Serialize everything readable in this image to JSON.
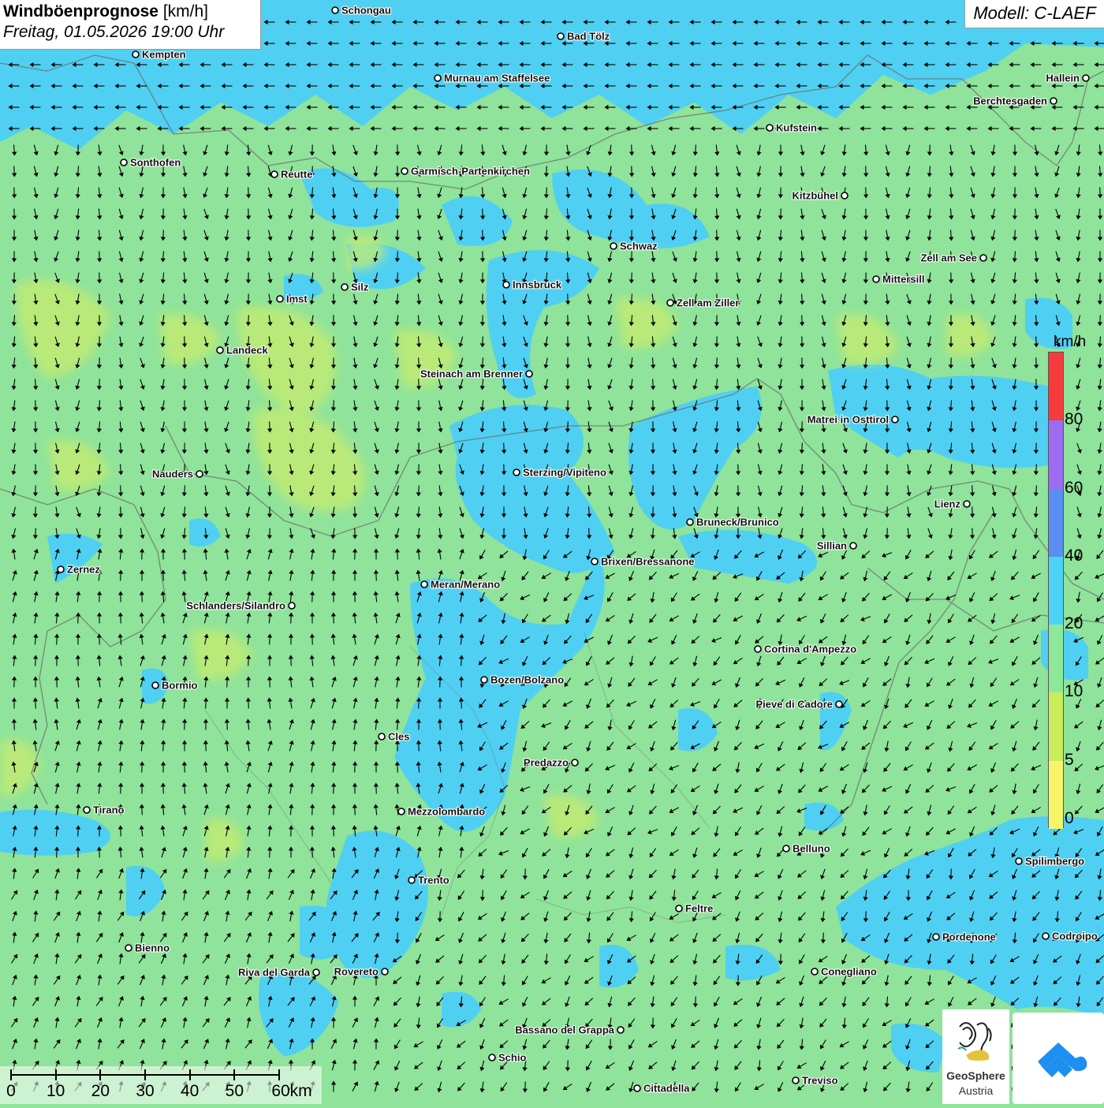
{
  "header": {
    "title_bold": "Windböenprognose",
    "title_unit": "[km/h]",
    "subtitle": "Freitag, 01.05.2026 19:00 Uhr",
    "model": "Modell: C-LAEF"
  },
  "legend": {
    "unit": "km/h",
    "ticks": [
      "80",
      "60",
      "40",
      "20",
      "10",
      "5",
      "0"
    ],
    "colors": [
      "#f53b3b",
      "#9b6cf0",
      "#5a8ef0",
      "#4cd2f5",
      "#8ee89a",
      "#c8ee5a",
      "#f6f56a"
    ]
  },
  "scale_bar": {
    "labels": [
      "0",
      "10",
      "20",
      "30",
      "40",
      "50",
      "60km"
    ]
  },
  "logos": {
    "geosphere_line1": "GeoSphere",
    "geosphere_line2": "Austria",
    "app_icon": "weather-app-cloud-arrow-icon"
  },
  "cities": [
    {
      "name": "Schongau"
    },
    {
      "name": "Bad Tölz"
    },
    {
      "name": "Kempten"
    },
    {
      "name": "Murnau am Staffelsee"
    },
    {
      "name": "Hallein"
    },
    {
      "name": "Berchtesgaden"
    },
    {
      "name": "Kufstein"
    },
    {
      "name": "Sonthofen"
    },
    {
      "name": "Reutte"
    },
    {
      "name": "Garmisch-Partenkirchen"
    },
    {
      "name": "Kitzbühel"
    },
    {
      "name": "Schwaz"
    },
    {
      "name": "Zell am See"
    },
    {
      "name": "Mittersill"
    },
    {
      "name": "Innsbruck"
    },
    {
      "name": "Silz"
    },
    {
      "name": "Imst"
    },
    {
      "name": "Zell am Ziller"
    },
    {
      "name": "Landeck"
    },
    {
      "name": "Steinach am Brenner"
    },
    {
      "name": "Matrei in Osttirol"
    },
    {
      "name": "Nauders"
    },
    {
      "name": "Sterzing/Vipiteno"
    },
    {
      "name": "Lienz"
    },
    {
      "name": "Bruneck/Brunico"
    },
    {
      "name": "Sillian"
    },
    {
      "name": "Zernez"
    },
    {
      "name": "Brixen/Bressanone"
    },
    {
      "name": "Meran/Merano"
    },
    {
      "name": "Schlanders/Silandro"
    },
    {
      "name": "Cortina d'Ampezzo"
    },
    {
      "name": "Bormio"
    },
    {
      "name": "Bozen/Bolzano"
    },
    {
      "name": "Pieve di Cadore"
    },
    {
      "name": "Cles"
    },
    {
      "name": "Predazzo"
    },
    {
      "name": "Tirano"
    },
    {
      "name": "Mezzolombardo"
    },
    {
      "name": "Belluno"
    },
    {
      "name": "Spilimbergo"
    },
    {
      "name": "Trento"
    },
    {
      "name": "Feltre"
    },
    {
      "name": "Bienno"
    },
    {
      "name": "Pordenone"
    },
    {
      "name": "Codroipo"
    },
    {
      "name": "Riva del Garda"
    },
    {
      "name": "Rovereto"
    },
    {
      "name": "Conegliano"
    },
    {
      "name": "Bassano del Grappa"
    },
    {
      "name": "Schio"
    },
    {
      "name": "Treviso"
    },
    {
      "name": "Cittadella"
    }
  ]
}
